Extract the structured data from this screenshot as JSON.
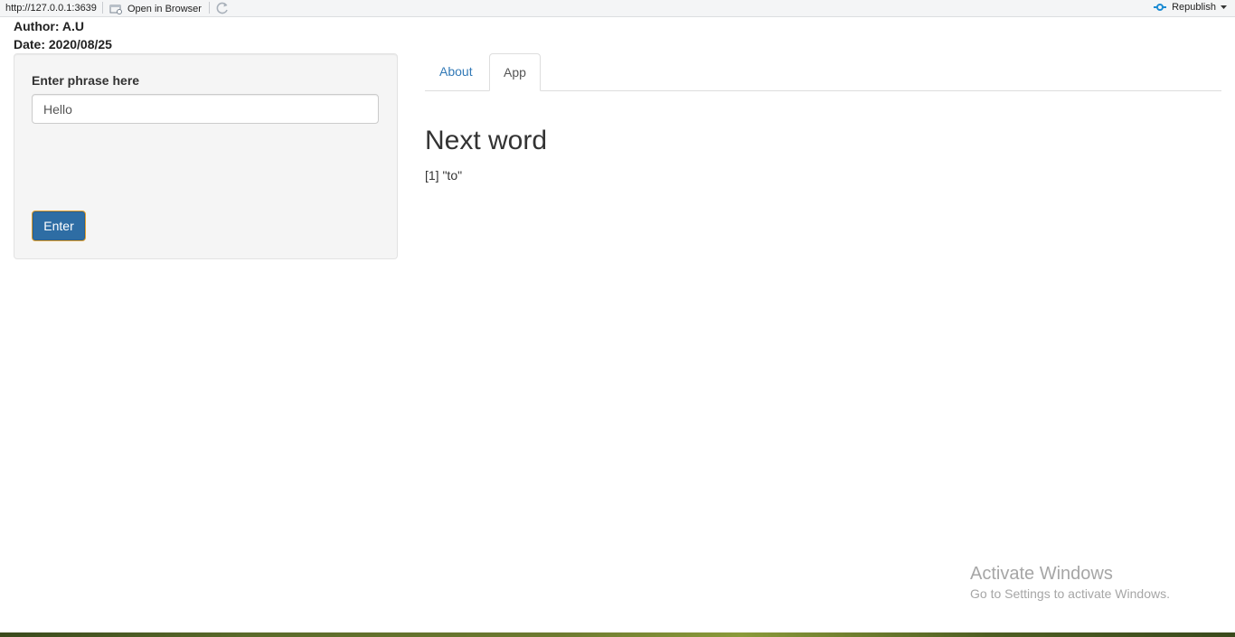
{
  "toolbar": {
    "url": "http://127.0.0.1:3639",
    "open_in_browser": "Open in Browser",
    "republish": "Republish",
    "republish_color": "#1d8cd3"
  },
  "header": {
    "author": "Author: A.U",
    "date": "Date: 2020/08/25"
  },
  "sidebar": {
    "input_label": "Enter phrase here",
    "input_value": "Hello",
    "enter_button": "Enter",
    "button_color": "#2e6da4"
  },
  "tabs": [
    {
      "label": "About",
      "active": false
    },
    {
      "label": "App",
      "active": true
    }
  ],
  "main": {
    "heading": "Next word",
    "output": "[1] \"to\""
  },
  "watermark": {
    "title": "Activate Windows",
    "subtitle": "Go to Settings to activate Windows."
  },
  "colors": {
    "link": "#337ab7",
    "text": "#333333",
    "well_bg": "#f5f5f5"
  }
}
